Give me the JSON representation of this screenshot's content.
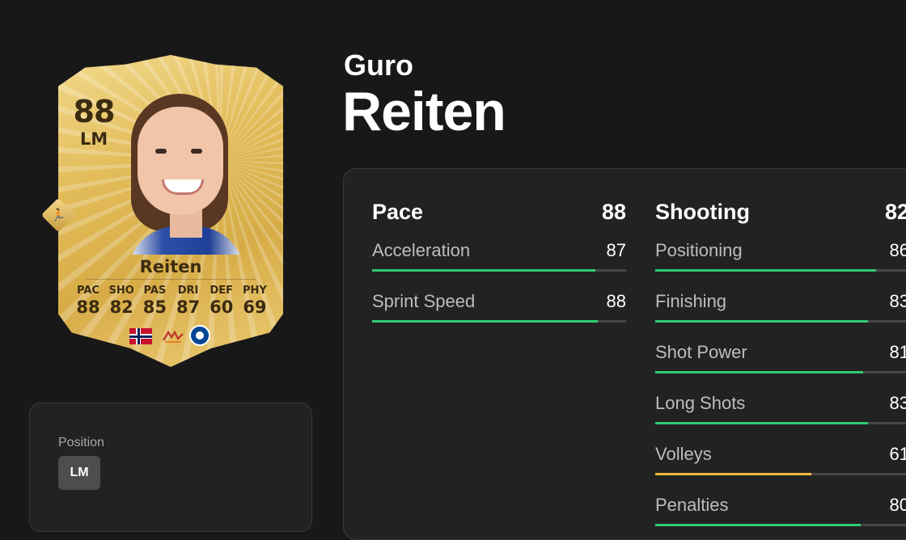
{
  "card": {
    "rating": "88",
    "position": "LM",
    "name": "Reiten",
    "stats": [
      {
        "label": "PAC",
        "value": "88"
      },
      {
        "label": "SHO",
        "value": "82"
      },
      {
        "label": "PAS",
        "value": "85"
      },
      {
        "label": "DRI",
        "value": "87"
      },
      {
        "label": "DEF",
        "value": "60"
      },
      {
        "label": "PHY",
        "value": "69"
      }
    ]
  },
  "position_box": {
    "label": "Position",
    "value": "LM"
  },
  "player": {
    "first_name": "Guro",
    "last_name": "Reiten"
  },
  "stat_groups": [
    {
      "title": "Pace",
      "value": "88",
      "rows": [
        {
          "name": "Acceleration",
          "value": "87",
          "color": "#2ecc71"
        },
        {
          "name": "Sprint Speed",
          "value": "88",
          "color": "#2ecc71"
        }
      ]
    },
    {
      "title": "Shooting",
      "value": "82",
      "rows": [
        {
          "name": "Positioning",
          "value": "86",
          "color": "#2ecc71"
        },
        {
          "name": "Finishing",
          "value": "83",
          "color": "#2ecc71"
        },
        {
          "name": "Shot Power",
          "value": "81",
          "color": "#2ecc71"
        },
        {
          "name": "Long Shots",
          "value": "83",
          "color": "#2ecc71"
        },
        {
          "name": "Volleys",
          "value": "61",
          "color": "#f0b93a"
        },
        {
          "name": "Penalties",
          "value": "80",
          "color": "#2ecc71"
        }
      ]
    }
  ]
}
